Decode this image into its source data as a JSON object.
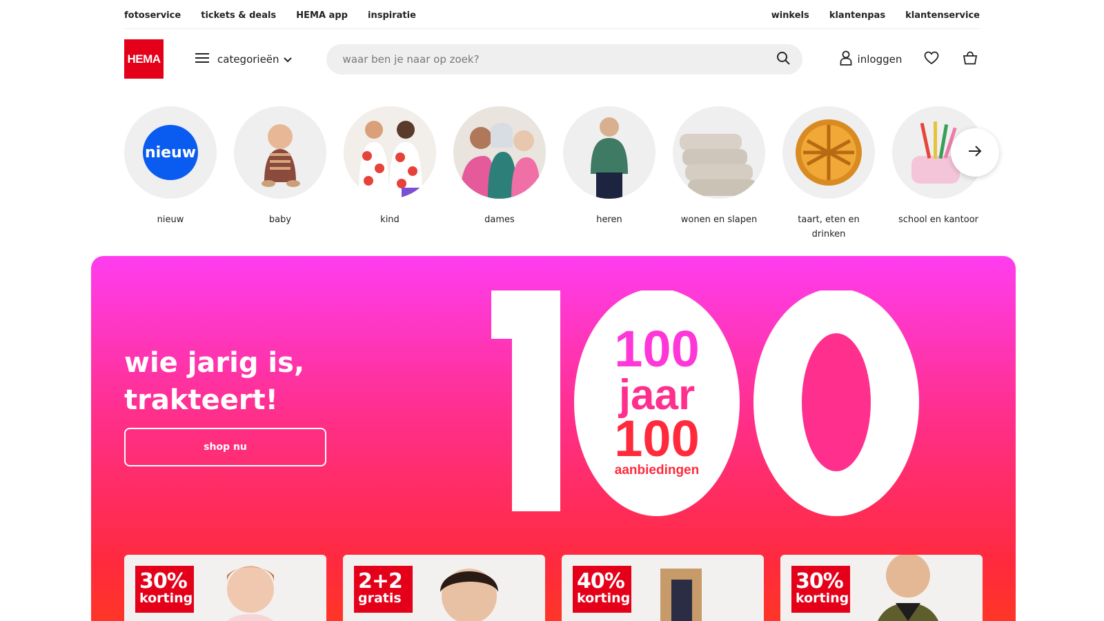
{
  "topbar": {
    "left_links": [
      "fotoservice",
      "tickets & deals",
      "HEMA app",
      "inspiratie"
    ],
    "right_links": [
      "winkels",
      "klantenpas",
      "klantenservice"
    ]
  },
  "header": {
    "logo_text": "HEMA",
    "categories_label": "categorieën",
    "search_placeholder": "waar ben je naar op zoek?",
    "login_label": "inloggen"
  },
  "categories": [
    {
      "label": "nieuw",
      "icon": "nieuw-badge"
    },
    {
      "label": "baby",
      "icon": "baby-photo"
    },
    {
      "label": "kind",
      "icon": "kids-photo"
    },
    {
      "label": "dames",
      "icon": "women-photo"
    },
    {
      "label": "heren",
      "icon": "men-photo"
    },
    {
      "label": "wonen en slapen",
      "icon": "towels-photo"
    },
    {
      "label": "taart, eten en drinken",
      "icon": "pie-photo"
    },
    {
      "label": "school en kantoor",
      "icon": "stationery-photo"
    }
  ],
  "nieuw_badge_text": "nieuw",
  "hero": {
    "headline_line1": "wie jarig is,",
    "headline_line2": "trakteert!",
    "shop_button": "shop nu",
    "logo_line1": "100",
    "logo_line2": "jaar",
    "logo_line3": "100",
    "logo_line4": "aanbiedingen",
    "colors": {
      "top": "#ff3df0",
      "bottom": "#ff3a1f",
      "brand_red": "#e5001a",
      "blue": "#0a5bf0"
    }
  },
  "offers": [
    {
      "big": "30%",
      "small": "korting"
    },
    {
      "big": "2+2",
      "small": "gratis"
    },
    {
      "big": "40%",
      "small": "korting"
    },
    {
      "big": "30%",
      "small": "korting"
    }
  ]
}
